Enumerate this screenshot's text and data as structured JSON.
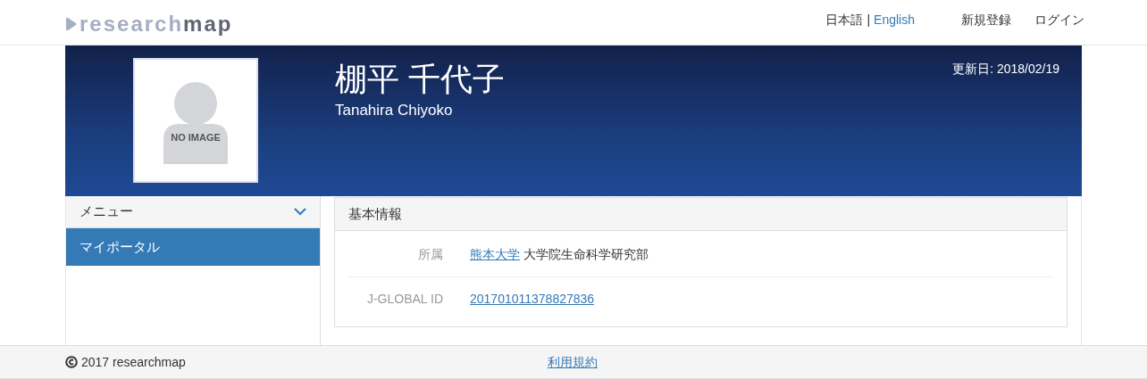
{
  "header": {
    "logo": {
      "light": "research",
      "dark": "map"
    },
    "languages": [
      {
        "label": "日本語",
        "selected": true
      },
      {
        "label": "English",
        "selected": false
      }
    ],
    "separator": "|",
    "links": [
      "新規登録",
      "ログイン"
    ]
  },
  "profile": {
    "photo_text": "NO IMAGE",
    "name": "棚平 千代子",
    "name_en": "Tanahira Chiyoko",
    "updated": "更新日: 2018/02/19"
  },
  "sidebar": {
    "title": "メニュー",
    "items": [
      {
        "label": "マイポータル",
        "selected": true
      }
    ]
  },
  "panel": {
    "title": "基本情報",
    "rows": [
      {
        "label": "所属",
        "link": "熊本大学",
        "text": "大学院生命科学研究部"
      },
      {
        "label": "J-GLOBAL ID",
        "link": "201701011378827836"
      }
    ]
  },
  "footer": {
    "copyright": "2017 researchmap",
    "link": "利用規約"
  }
}
